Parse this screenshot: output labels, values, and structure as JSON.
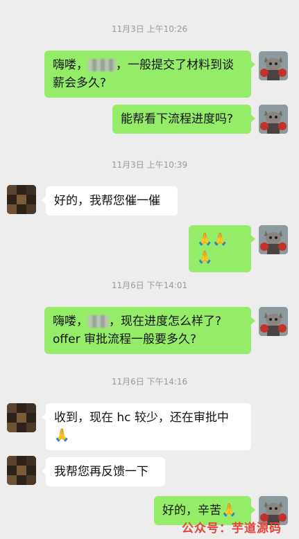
{
  "timestamps": [
    "11月3日 上午10:26",
    "11月3日 上午10:39",
    "11月6日 下午14:01",
    "11月6日 下午14:16"
  ],
  "messages": [
    {
      "side": "me",
      "parts": [
        "嗨喽，",
        "，一般提交了材料到谈",
        "薪会多久?"
      ]
    },
    {
      "side": "me",
      "text": "能帮看下流程进度吗?"
    },
    {
      "side": "them",
      "text": "好的，我帮您催一催"
    },
    {
      "side": "me",
      "emoji": "🙏🙏🙏"
    },
    {
      "side": "me",
      "parts": [
        "嗨喽，",
        "，现在进度怎么样了?",
        "offer 审批流程一般要多久?"
      ]
    },
    {
      "side": "them",
      "text": "收到，现在 hc 较少，还在审批中",
      "emoji": "🙏"
    },
    {
      "side": "them",
      "text": "我帮您再反馈一下"
    },
    {
      "side": "me",
      "text": "好的，辛苦",
      "emoji": "🙏"
    }
  ],
  "watermark": "公众号：芋道源码"
}
